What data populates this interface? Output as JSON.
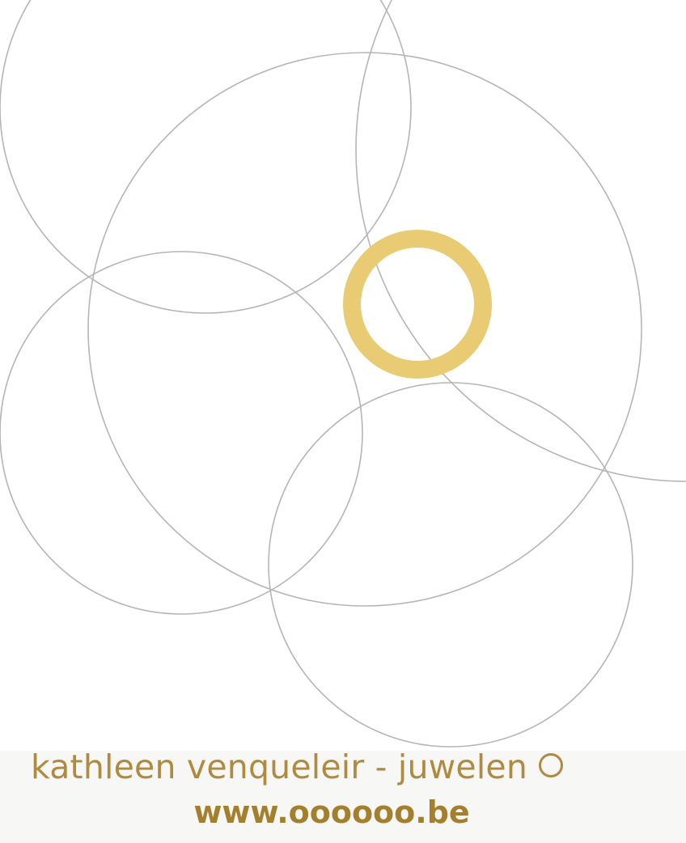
{
  "brand": {
    "name": "kathleen venqueleir - juwelen",
    "url": "www.oooooo.be",
    "ring_icon": "circle-outline-icon"
  },
  "colors": {
    "line_circles": "#b3b3b3",
    "gold_ring": "#e8cb72",
    "brand_text": "#b08a3e",
    "url_text": "#a47f2e",
    "footer_background": "#f7f8f6"
  }
}
